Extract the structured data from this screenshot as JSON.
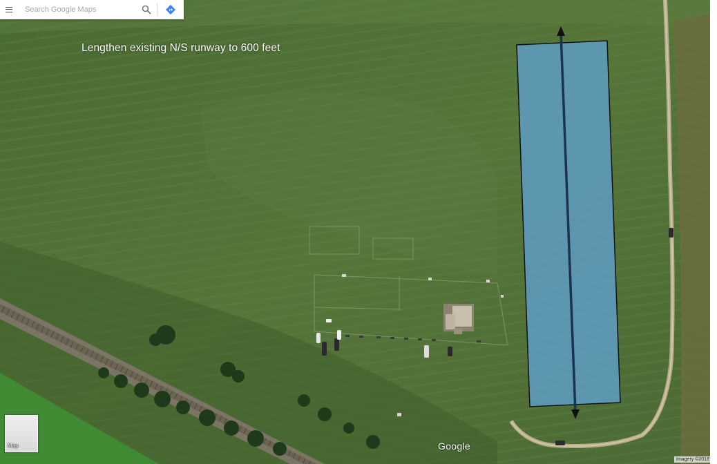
{
  "search": {
    "placeholder": "Search Google Maps"
  },
  "icons": {
    "menu": "menu-icon",
    "search": "search-icon",
    "directions": "directions-icon"
  },
  "annotation": {
    "text": "Lengthen existing N/S runway to 600 feet"
  },
  "layer_thumbnail": {
    "label": "Map"
  },
  "attribution": {
    "logo": "Google",
    "imagery": "Imagery ©2018"
  },
  "colors": {
    "runway_fill": "#5f9ec9",
    "runway_outline": "#111111",
    "centerline": "#1b3350",
    "field": "#4d6a34",
    "directions_blue": "#4285f4"
  }
}
